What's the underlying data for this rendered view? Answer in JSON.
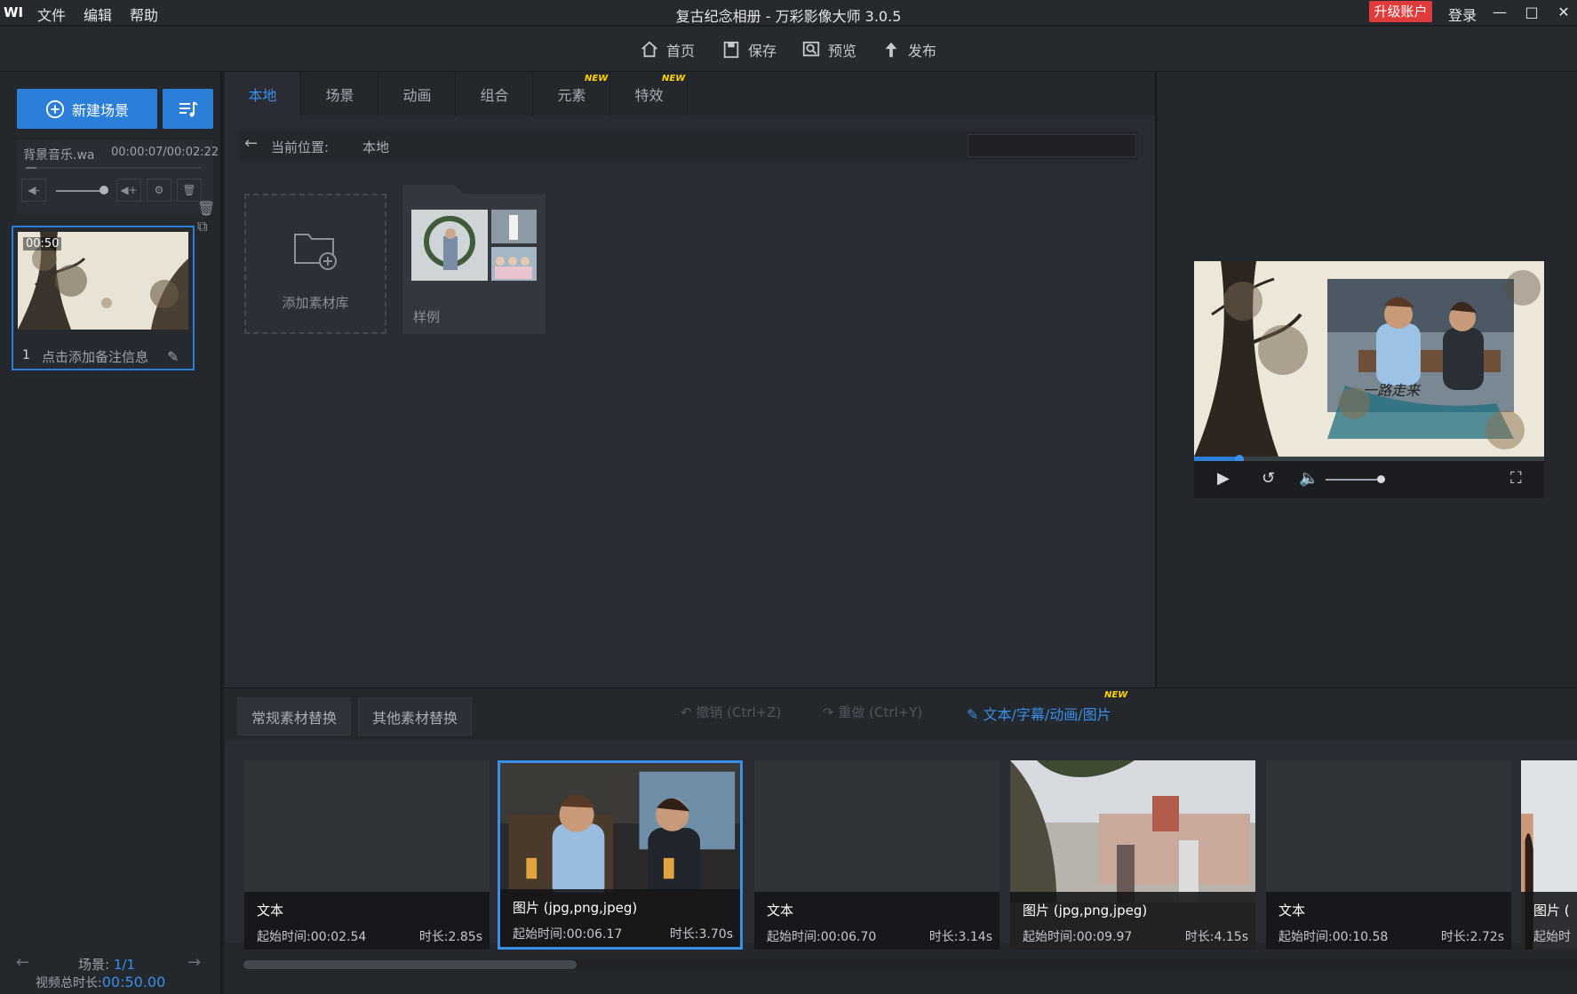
{
  "window": {
    "logo": "WI",
    "title": "复古纪念相册 - 万彩影像大师 3.0.5",
    "menu": [
      "文件",
      "编辑",
      "帮助"
    ],
    "upgrade": "升级账户",
    "login": "登录"
  },
  "toolbar": {
    "home": "首页",
    "save": "保存",
    "preview": "预览",
    "publish": "发布"
  },
  "left": {
    "new_scene": "新建场景",
    "music_name": "背景音乐.wa",
    "music_time": "00:00:07/00:02:22",
    "music_progress": 0.06,
    "volume": 0.85,
    "scene": {
      "duration": "00:50",
      "index": "1",
      "note_placeholder": "点击添加备注信息"
    },
    "scene_count_label": "场景:",
    "scene_count": "1/1",
    "total_label": "视频总时长:",
    "total_duration": "00:50.00"
  },
  "library": {
    "tabs": [
      {
        "label": "本地",
        "active": true,
        "new": false
      },
      {
        "label": "场景",
        "active": false,
        "new": false
      },
      {
        "label": "动画",
        "active": false,
        "new": false
      },
      {
        "label": "组合",
        "active": false,
        "new": false
      },
      {
        "label": "元素",
        "active": false,
        "new": true
      },
      {
        "label": "特效",
        "active": false,
        "new": true
      }
    ],
    "new_badge": "NEW",
    "location_label": "当前位置:",
    "location_value": "本地",
    "search_placeholder": "",
    "add_library": "添加素材库",
    "sample_folder": "样例"
  },
  "preview": {
    "progress": 0.13,
    "caption": "一路走来"
  },
  "bottom": {
    "tab_regular": "常规素材替换",
    "tab_other": "其他素材替换",
    "undo": "撤销 (Ctrl+Z)",
    "redo": "重做 (Ctrl+Y)",
    "text_edit": "文本/字幕/动画/图片",
    "new_badge": "NEW",
    "clips": [
      {
        "type": "文本",
        "start": "起始时间:00:02.54",
        "duration": "时长:2.85s",
        "kind": "text",
        "selected": false
      },
      {
        "type": "图片 (jpg,png,jpeg)",
        "start": "起始时间:00:06.17",
        "duration": "时长:3.70s",
        "kind": "photo1",
        "selected": true
      },
      {
        "type": "文本",
        "start": "起始时间:00:06.70",
        "duration": "时长:3.14s",
        "kind": "text",
        "selected": false
      },
      {
        "type": "图片 (jpg,png,jpeg)",
        "start": "起始时间:00:09.97",
        "duration": "时长:4.15s",
        "kind": "photo2",
        "selected": false
      },
      {
        "type": "文本",
        "start": "起始时间:00:10.58",
        "duration": "时长:2.72s",
        "kind": "text",
        "selected": false
      },
      {
        "type": "图片 (",
        "start": "起始时",
        "duration": "",
        "kind": "photo3",
        "selected": false
      }
    ],
    "scroll": 0.25
  },
  "colors": {
    "accent": "#2b7fd8",
    "upgrade": "#e03b3b",
    "badge": "#ffd400"
  }
}
